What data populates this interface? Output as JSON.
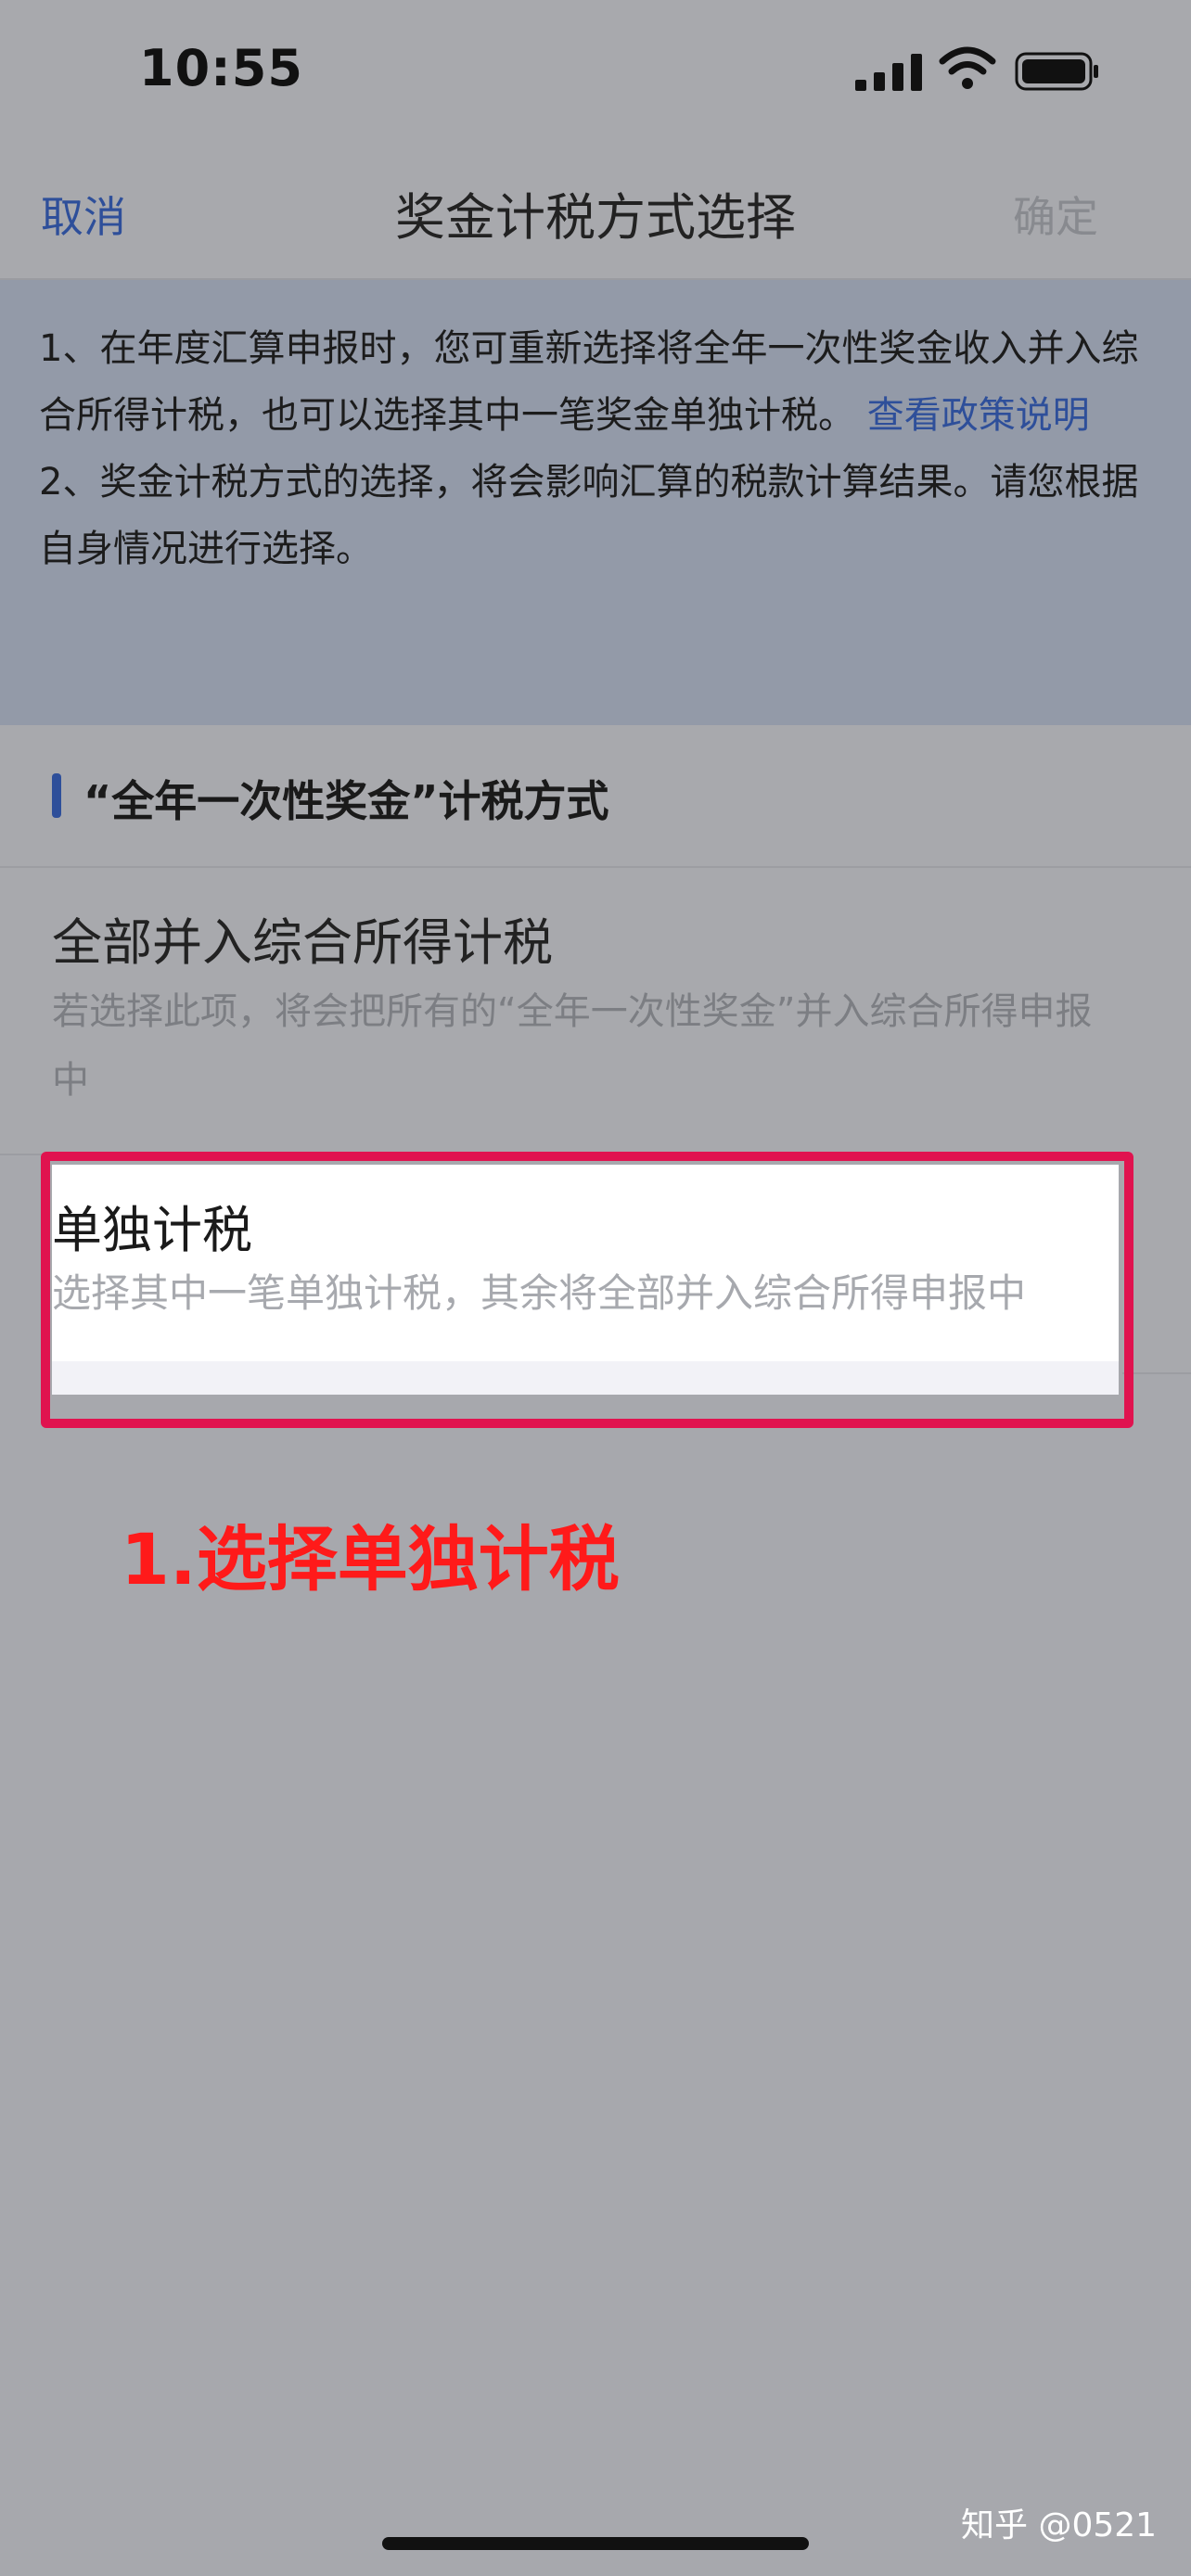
{
  "status_bar": {
    "time": "10:55"
  },
  "nav": {
    "cancel_label": "取消",
    "title": "奖金计税方式选择",
    "confirm_label": "确定"
  },
  "notice": {
    "line1_text": "1、在年度汇算申报时，您可重新选择将全年一次性奖金收入并入综合所得计税，也可以选择其中一笔奖金单独计税。",
    "link_label": "查看政策说明",
    "line2_text": "2、奖金计税方式的选择，将会影响汇算的税款计算结果。请您根据自身情况进行选择。"
  },
  "section": {
    "title": "“全年一次性奖金”计税方式"
  },
  "options": [
    {
      "title": "全部并入综合所得计税",
      "description": "若选择此项，将会把所有的“全年一次性奖金”并入综合所得申报中"
    },
    {
      "title": "单独计税",
      "description": "选择其中一笔单独计税，其余将全部并入综合所得申报中"
    }
  ],
  "annotation": {
    "text": "1.选择单独计税",
    "color": "#ff1a1a"
  },
  "watermark": {
    "text": "知乎 @0521"
  },
  "colors": {
    "accent": "#2e4f9a",
    "highlight_border": "#e0134f"
  }
}
